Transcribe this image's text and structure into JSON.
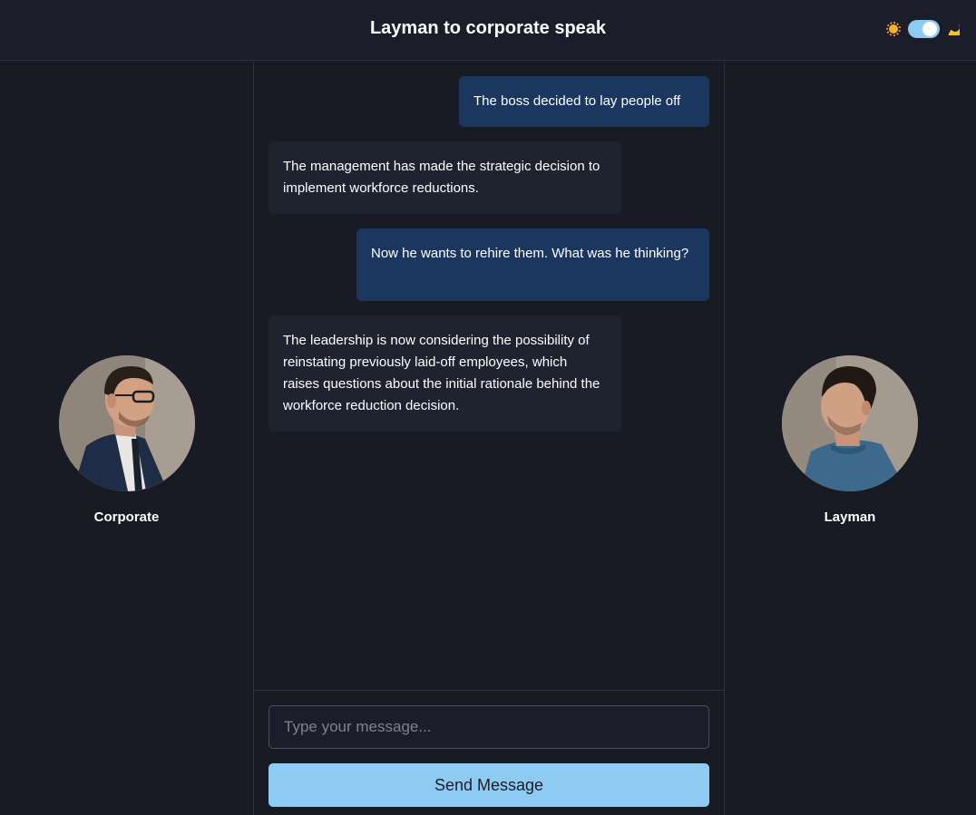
{
  "header": {
    "title": "Layman to corporate speak",
    "theme_toggle": {
      "light_icon": "sun-icon",
      "dark_icon": "moon-icon",
      "dark_mode_on": true
    }
  },
  "personas": {
    "left": {
      "name": "Corporate",
      "icon": "avatar-corporate"
    },
    "right": {
      "name": "Layman",
      "icon": "avatar-layman"
    }
  },
  "messages": [
    {
      "role": "user",
      "text": "The boss decided to lay people off"
    },
    {
      "role": "bot",
      "text": "The management has made the strategic decision to implement workforce reductions."
    },
    {
      "role": "user",
      "text": "Now he wants to rehire them. What was he thinking?"
    },
    {
      "role": "bot",
      "text": "The leadership is now considering the possibility of reinstating previously laid-off employees, which raises questions about the initial rationale behind the workforce reduction decision."
    }
  ],
  "composer": {
    "placeholder": "Type your message...",
    "value": "",
    "send_label": "Send Message"
  },
  "colors": {
    "background": "#181a24",
    "user_bubble": "#1b3760",
    "bot_bubble": "#1f2330",
    "accent": "#8ecbf2"
  }
}
